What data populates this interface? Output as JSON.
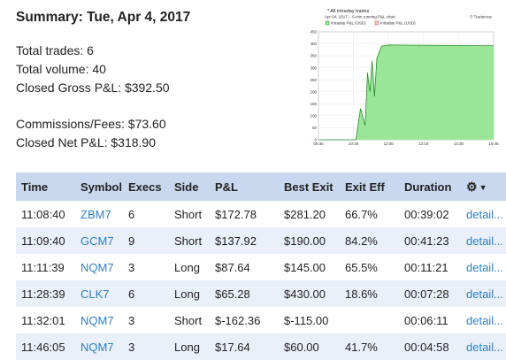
{
  "summary": {
    "title": "Summary: Tue, Apr 4, 2017",
    "total_trades": "Total trades: 6",
    "total_volume": "Total volume: 40",
    "closed_gross": "Closed Gross P&L: $392.50",
    "commissions": "Commissions/Fees: $73.60",
    "closed_net": "Closed Net P&L: $318.90"
  },
  "chart": {
    "title": "* All intraday trades",
    "subtitle": "Apr 04, 2017 -- 5-min running P&L chart",
    "brand": "© Tradervue",
    "legend": [
      "Intraday P&L (USD)",
      "Intraday P&L (USD)"
    ],
    "fill_color": "#99e699",
    "line_color": "#2a8a2a"
  },
  "chart_data": {
    "type": "area",
    "title": "* All intraday trades",
    "subtitle": "Apr 04, 2017 -- 5-min running P&L chart",
    "x_ticks": [
      "09:30",
      "10:45",
      "12:00",
      "13:15",
      "14:30",
      "15:45"
    ],
    "y_ticks": [
      "0",
      "50",
      "100",
      "150",
      "200",
      "250",
      "300",
      "350",
      "400",
      "450"
    ],
    "ylim": [
      0,
      450
    ],
    "series": [
      {
        "name": "Intraday P&L (USD)",
        "x": [
          "09:30",
          "10:50",
          "11:00",
          "11:10",
          "11:15",
          "11:20",
          "11:25",
          "11:30",
          "11:35",
          "11:45",
          "12:00",
          "15:45"
        ],
        "y": [
          0,
          0,
          130,
          60,
          280,
          200,
          330,
          180,
          340,
          390,
          395,
          392
        ]
      }
    ],
    "grid": true
  },
  "table": {
    "headers": [
      "Time",
      "Symbol",
      "Execs",
      "Side",
      "P&L",
      "Best Exit",
      "Exit Eff",
      "Duration"
    ],
    "settings_icon": "gear-icon",
    "rows": [
      {
        "time": "11:08:40",
        "symbol": "ZBM7",
        "execs": "6",
        "side": "Short",
        "pnl": "$172.78",
        "best_exit": "$281.20",
        "exit_eff": "66.7%",
        "duration": "00:39:02",
        "detail": "detail..."
      },
      {
        "time": "11:09:40",
        "symbol": "GCM7",
        "execs": "9",
        "side": "Short",
        "pnl": "$137.92",
        "best_exit": "$190.00",
        "exit_eff": "84.2%",
        "duration": "00:41:23",
        "detail": "detail..."
      },
      {
        "time": "11:11:39",
        "symbol": "NQM7",
        "execs": "3",
        "side": "Long",
        "pnl": "$87.64",
        "best_exit": "$145.00",
        "exit_eff": "65.5%",
        "duration": "00:11:21",
        "detail": "detail..."
      },
      {
        "time": "11:28:39",
        "symbol": "CLK7",
        "execs": "6",
        "side": "Long",
        "pnl": "$65.28",
        "best_exit": "$430.00",
        "exit_eff": "18.6%",
        "duration": "00:07:28",
        "detail": "detail..."
      },
      {
        "time": "11:32:01",
        "symbol": "NQM7",
        "execs": "3",
        "side": "Short",
        "pnl": "$-162.36",
        "best_exit": "$-115.00",
        "exit_eff": "",
        "duration": "00:06:11",
        "detail": "detail..."
      },
      {
        "time": "11:46:05",
        "symbol": "NQM7",
        "execs": "3",
        "side": "Long",
        "pnl": "$17.64",
        "best_exit": "$60.00",
        "exit_eff": "41.7%",
        "duration": "00:04:58",
        "detail": "detail..."
      }
    ]
  }
}
